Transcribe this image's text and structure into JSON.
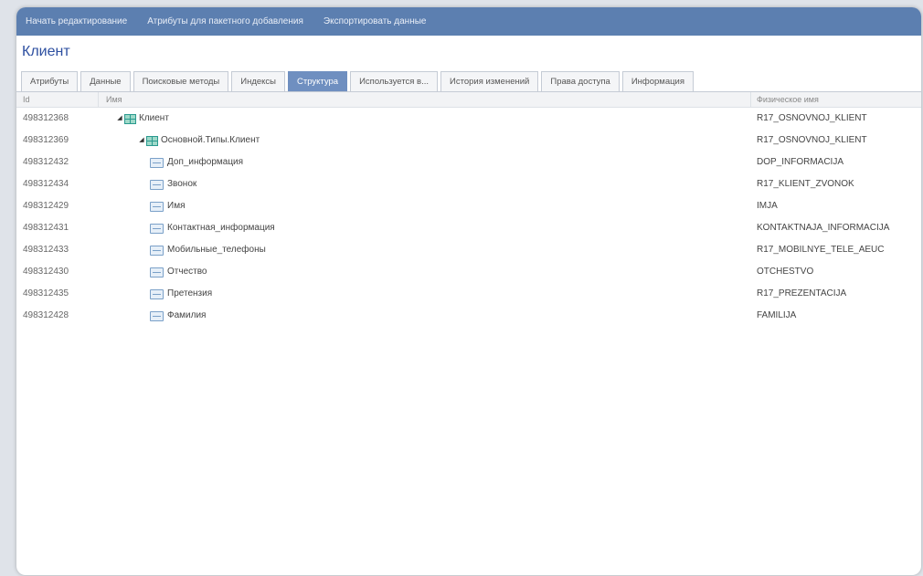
{
  "toolbar": {
    "items": [
      "Начать редактирование",
      "Атрибуты для пакетного добавления",
      "Экспортировать данные"
    ]
  },
  "title": "Клиент",
  "tabs": [
    {
      "label": "Атрибуты",
      "active": false
    },
    {
      "label": "Данные",
      "active": false
    },
    {
      "label": "Поисковые методы",
      "active": false
    },
    {
      "label": "Индексы",
      "active": false
    },
    {
      "label": "Структура",
      "active": true
    },
    {
      "label": "Используется в...",
      "active": false
    },
    {
      "label": "История изменений",
      "active": false
    },
    {
      "label": "Права доступа",
      "active": false
    },
    {
      "label": "Информация",
      "active": false
    }
  ],
  "grid": {
    "headers": {
      "id": "Id",
      "name": "Имя",
      "physical": "Физическое имя"
    },
    "rows": [
      {
        "id": "498312368",
        "name": "Клиент",
        "physical": "R17_OSNOVNOJ_KLIENT",
        "icon": "table-icon",
        "level": 0,
        "expander": "◢"
      },
      {
        "id": "498312369",
        "name": "Основной.Типы.Клиент",
        "physical": "R17_OSNOVNOJ_KLIENT",
        "icon": "table-icon",
        "level": 1,
        "expander": "◢"
      },
      {
        "id": "498312432",
        "name": "Доп_информация",
        "physical": "DOP_INFORMACIJA",
        "icon": "field-icon",
        "level": 2
      },
      {
        "id": "498312434",
        "name": "Звонок",
        "physical": "R17_KLIENT_ZVONOK",
        "icon": "field-icon",
        "level": 2
      },
      {
        "id": "498312429",
        "name": "Имя",
        "physical": "IMJA",
        "icon": "field-icon",
        "level": 2
      },
      {
        "id": "498312431",
        "name": "Контактная_информация",
        "physical": "KONTAKTNAJA_INFORMACIJA",
        "icon": "field-icon",
        "level": 2
      },
      {
        "id": "498312433",
        "name": "Мобильные_телефоны",
        "physical": "R17_MOBILNYE_TELE_AEUC",
        "icon": "field-icon",
        "level": 2
      },
      {
        "id": "498312430",
        "name": "Отчество",
        "physical": "OTCHESTVO",
        "icon": "field-icon",
        "level": 2
      },
      {
        "id": "498312435",
        "name": "Претензия",
        "physical": "R17_PREZENTACIJA",
        "icon": "field-icon",
        "level": 2
      },
      {
        "id": "498312428",
        "name": "Фамилия",
        "physical": "FAMILIJA",
        "icon": "field-icon",
        "level": 2
      }
    ]
  }
}
